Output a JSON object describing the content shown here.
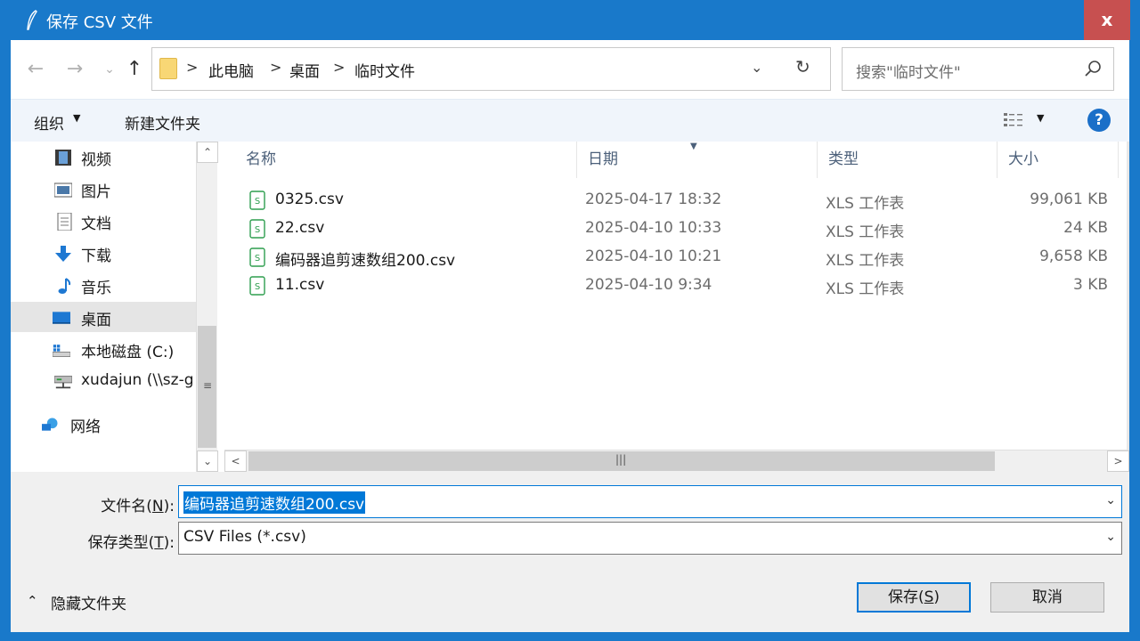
{
  "window": {
    "title": "保存 CSV 文件",
    "close_label": "x"
  },
  "address_bar": {
    "breadcrumbs": [
      "此电脑",
      "桌面",
      "临时文件"
    ],
    "separator": ">",
    "dropdown_glyph": "⌄",
    "refresh_glyph": "↻"
  },
  "search": {
    "placeholder": "搜索\"临时文件\""
  },
  "toolbar": {
    "organize_label": "组织",
    "new_folder_label": "新建文件夹",
    "help_label": "?"
  },
  "nav_pane": {
    "items": [
      {
        "label": "视频",
        "icon": "video-icon"
      },
      {
        "label": "图片",
        "icon": "pictures-icon"
      },
      {
        "label": "文档",
        "icon": "documents-icon"
      },
      {
        "label": "下载",
        "icon": "downloads-icon"
      },
      {
        "label": "音乐",
        "icon": "music-icon"
      },
      {
        "label": "桌面",
        "icon": "desktop-icon",
        "selected": true
      },
      {
        "label": "本地磁盘 (C:)",
        "icon": "drive-icon"
      },
      {
        "label": "xudajun (\\\\sz-g",
        "icon": "network-drive-icon"
      },
      {
        "label": "网络",
        "icon": "network-icon"
      }
    ]
  },
  "file_list": {
    "columns": [
      "名称",
      "日期",
      "类型",
      "大小"
    ],
    "rows": [
      {
        "name": "0325.csv",
        "date": "2025-04-17 18:32",
        "type": "XLS 工作表",
        "size": "99,061 KB"
      },
      {
        "name": "22.csv",
        "date": "2025-04-10 10:33",
        "type": "XLS 工作表",
        "size": "24 KB"
      },
      {
        "name": "编码器追剪速数组200.csv",
        "date": "2025-04-10 10:21",
        "type": "XLS 工作表",
        "size": "9,658 KB"
      },
      {
        "name": "11.csv",
        "date": "2025-04-10 9:34",
        "type": "XLS 工作表",
        "size": "3 KB"
      }
    ]
  },
  "form": {
    "filename_label": "文件名(",
    "filename_hotkey": "N",
    "filename_label_end": "):",
    "filename_value": "编码器追剪速数组200.csv",
    "filetype_label": "保存类型(",
    "filetype_hotkey": "T",
    "filetype_label_end": "):",
    "filetype_value": "CSV Files (*.csv)"
  },
  "footer": {
    "hide_folders_label": "隐藏文件夹",
    "save_label_prefix": "保存(",
    "save_hotkey": "S",
    "save_label_suffix": ")",
    "cancel_label": "取消"
  },
  "colors": {
    "titlebar": "#1979ca",
    "close_button": "#c75050",
    "accent": "#0078d7",
    "toolbar_bg": "#f0f5fb",
    "csv_icon_green": "#2e9e4f"
  }
}
